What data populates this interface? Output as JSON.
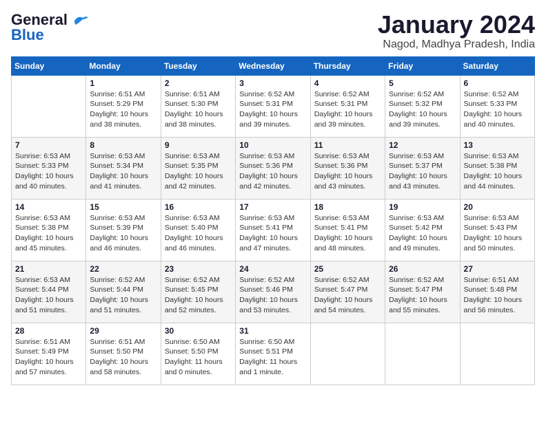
{
  "logo": {
    "line1": "General",
    "line2": "Blue"
  },
  "title": "January 2024",
  "location": "Nagod, Madhya Pradesh, India",
  "days_of_week": [
    "Sunday",
    "Monday",
    "Tuesday",
    "Wednesday",
    "Thursday",
    "Friday",
    "Saturday"
  ],
  "weeks": [
    [
      {
        "day": "",
        "info": ""
      },
      {
        "day": "1",
        "info": "Sunrise: 6:51 AM\nSunset: 5:29 PM\nDaylight: 10 hours\nand 38 minutes."
      },
      {
        "day": "2",
        "info": "Sunrise: 6:51 AM\nSunset: 5:30 PM\nDaylight: 10 hours\nand 38 minutes."
      },
      {
        "day": "3",
        "info": "Sunrise: 6:52 AM\nSunset: 5:31 PM\nDaylight: 10 hours\nand 39 minutes."
      },
      {
        "day": "4",
        "info": "Sunrise: 6:52 AM\nSunset: 5:31 PM\nDaylight: 10 hours\nand 39 minutes."
      },
      {
        "day": "5",
        "info": "Sunrise: 6:52 AM\nSunset: 5:32 PM\nDaylight: 10 hours\nand 39 minutes."
      },
      {
        "day": "6",
        "info": "Sunrise: 6:52 AM\nSunset: 5:33 PM\nDaylight: 10 hours\nand 40 minutes."
      }
    ],
    [
      {
        "day": "7",
        "info": "Sunrise: 6:53 AM\nSunset: 5:33 PM\nDaylight: 10 hours\nand 40 minutes."
      },
      {
        "day": "8",
        "info": "Sunrise: 6:53 AM\nSunset: 5:34 PM\nDaylight: 10 hours\nand 41 minutes."
      },
      {
        "day": "9",
        "info": "Sunrise: 6:53 AM\nSunset: 5:35 PM\nDaylight: 10 hours\nand 42 minutes."
      },
      {
        "day": "10",
        "info": "Sunrise: 6:53 AM\nSunset: 5:36 PM\nDaylight: 10 hours\nand 42 minutes."
      },
      {
        "day": "11",
        "info": "Sunrise: 6:53 AM\nSunset: 5:36 PM\nDaylight: 10 hours\nand 43 minutes."
      },
      {
        "day": "12",
        "info": "Sunrise: 6:53 AM\nSunset: 5:37 PM\nDaylight: 10 hours\nand 43 minutes."
      },
      {
        "day": "13",
        "info": "Sunrise: 6:53 AM\nSunset: 5:38 PM\nDaylight: 10 hours\nand 44 minutes."
      }
    ],
    [
      {
        "day": "14",
        "info": "Sunrise: 6:53 AM\nSunset: 5:38 PM\nDaylight: 10 hours\nand 45 minutes."
      },
      {
        "day": "15",
        "info": "Sunrise: 6:53 AM\nSunset: 5:39 PM\nDaylight: 10 hours\nand 46 minutes."
      },
      {
        "day": "16",
        "info": "Sunrise: 6:53 AM\nSunset: 5:40 PM\nDaylight: 10 hours\nand 46 minutes."
      },
      {
        "day": "17",
        "info": "Sunrise: 6:53 AM\nSunset: 5:41 PM\nDaylight: 10 hours\nand 47 minutes."
      },
      {
        "day": "18",
        "info": "Sunrise: 6:53 AM\nSunset: 5:41 PM\nDaylight: 10 hours\nand 48 minutes."
      },
      {
        "day": "19",
        "info": "Sunrise: 6:53 AM\nSunset: 5:42 PM\nDaylight: 10 hours\nand 49 minutes."
      },
      {
        "day": "20",
        "info": "Sunrise: 6:53 AM\nSunset: 5:43 PM\nDaylight: 10 hours\nand 50 minutes."
      }
    ],
    [
      {
        "day": "21",
        "info": "Sunrise: 6:53 AM\nSunset: 5:44 PM\nDaylight: 10 hours\nand 51 minutes."
      },
      {
        "day": "22",
        "info": "Sunrise: 6:52 AM\nSunset: 5:44 PM\nDaylight: 10 hours\nand 51 minutes."
      },
      {
        "day": "23",
        "info": "Sunrise: 6:52 AM\nSunset: 5:45 PM\nDaylight: 10 hours\nand 52 minutes."
      },
      {
        "day": "24",
        "info": "Sunrise: 6:52 AM\nSunset: 5:46 PM\nDaylight: 10 hours\nand 53 minutes."
      },
      {
        "day": "25",
        "info": "Sunrise: 6:52 AM\nSunset: 5:47 PM\nDaylight: 10 hours\nand 54 minutes."
      },
      {
        "day": "26",
        "info": "Sunrise: 6:52 AM\nSunset: 5:47 PM\nDaylight: 10 hours\nand 55 minutes."
      },
      {
        "day": "27",
        "info": "Sunrise: 6:51 AM\nSunset: 5:48 PM\nDaylight: 10 hours\nand 56 minutes."
      }
    ],
    [
      {
        "day": "28",
        "info": "Sunrise: 6:51 AM\nSunset: 5:49 PM\nDaylight: 10 hours\nand 57 minutes."
      },
      {
        "day": "29",
        "info": "Sunrise: 6:51 AM\nSunset: 5:50 PM\nDaylight: 10 hours\nand 58 minutes."
      },
      {
        "day": "30",
        "info": "Sunrise: 6:50 AM\nSunset: 5:50 PM\nDaylight: 11 hours\nand 0 minutes."
      },
      {
        "day": "31",
        "info": "Sunrise: 6:50 AM\nSunset: 5:51 PM\nDaylight: 11 hours\nand 1 minute."
      },
      {
        "day": "",
        "info": ""
      },
      {
        "day": "",
        "info": ""
      },
      {
        "day": "",
        "info": ""
      }
    ]
  ]
}
